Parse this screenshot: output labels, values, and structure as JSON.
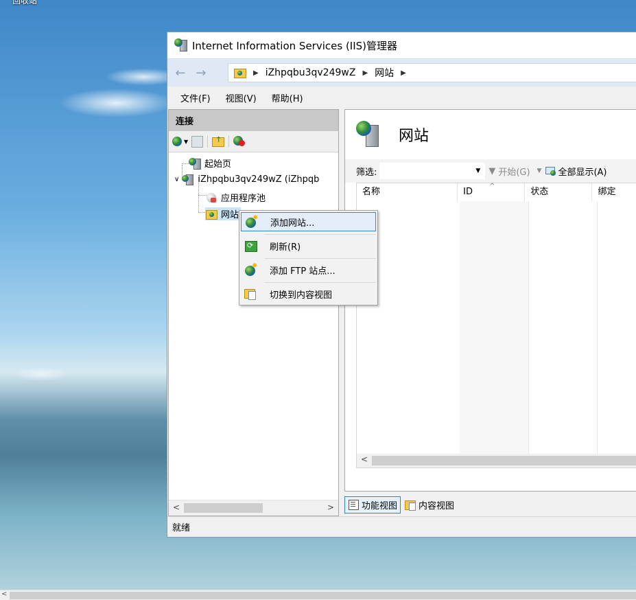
{
  "desktop": {
    "label": "回收站"
  },
  "window": {
    "title": "Internet Information Services (IIS)管理器",
    "address": [
      "iZhpqbu3qv249wZ",
      "网站"
    ],
    "menu": [
      "文件(F)",
      "视图(V)",
      "帮助(H)"
    ]
  },
  "connections": {
    "header": "连接",
    "tree": {
      "start_page": "起始页",
      "server": "iZhpqbu3qv249wZ (iZhpqb",
      "app_pools": "应用程序池",
      "sites": "网站"
    }
  },
  "main": {
    "title": "网站",
    "filter_label": "筛选:",
    "filter_value": "",
    "start_label": "开始(G)",
    "show_all_label": "全部显示(A)",
    "columns": [
      "名称",
      "ID",
      "状态",
      "绑定"
    ],
    "view_tabs": {
      "features": "功能视图",
      "content": "内容视图"
    }
  },
  "context_menu": {
    "items": [
      "添加网站...",
      "刷新(R)",
      "添加 FTP 站点...",
      "切换到内容视图"
    ]
  },
  "status": {
    "text": "就绪"
  }
}
